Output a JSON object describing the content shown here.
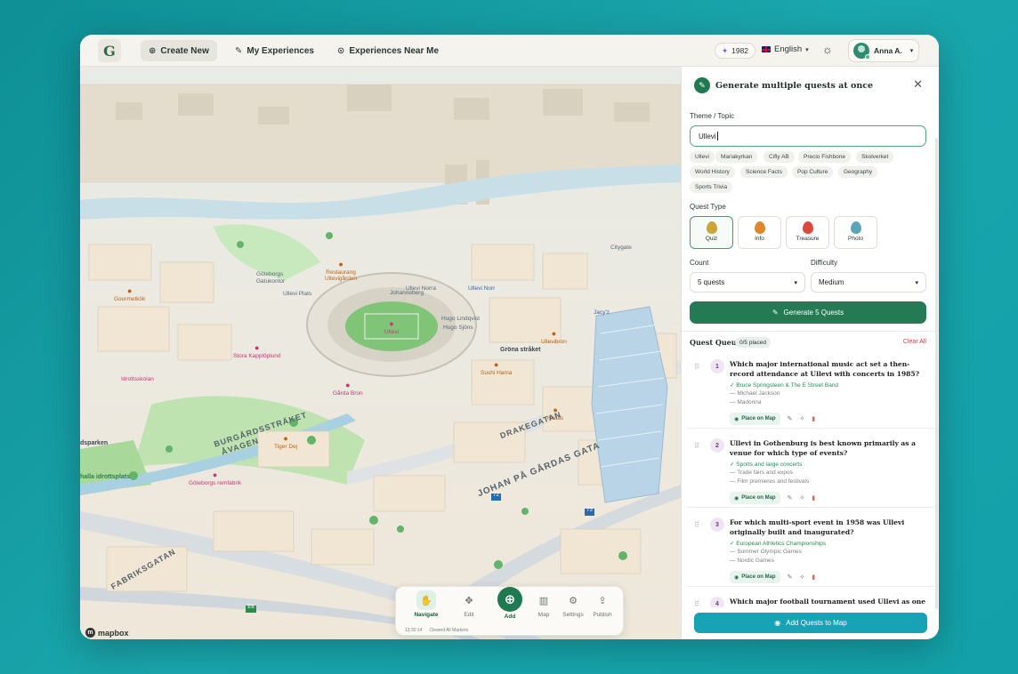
{
  "topbar": {
    "nav": [
      "Create New",
      "My Experiences",
      "Experiences Near Me"
    ],
    "points": "1982",
    "language": "English",
    "user": "Anna A."
  },
  "map": {
    "pois": [
      {
        "label": "Restaurang\nUllevigården",
        "color": "orange"
      },
      {
        "label": "Gourmetkök",
        "color": "orange"
      },
      {
        "label": "Ullevi",
        "color": "pink"
      },
      {
        "label": "Stora Kapplöplund",
        "color": "pink"
      },
      {
        "label": "Gårda Bron",
        "color": "pink"
      },
      {
        "label": "Sushi Hama",
        "color": "orange"
      },
      {
        "label": "Hildas",
        "color": "orange"
      },
      {
        "label": "Tiger Dej",
        "color": "orange"
      },
      {
        "label": "Göteborgs remfabrik",
        "color": "pink"
      },
      {
        "label": "Ullevi Norr",
        "color": "blue"
      },
      {
        "label": "Jacy'z",
        "color": "blue"
      },
      {
        "label": "Ullevibron",
        "color": "orange"
      },
      {
        "label": "Idrottsskolan",
        "color": "pink"
      }
    ],
    "streets": [
      "Göteborgs",
      "Gatukontor",
      "Ullevi Plats",
      "Ullevi Norra",
      "Johanneberg",
      "Hugo Lindqvist",
      "Hugo Sjöns",
      "Citygate",
      "Gröna stråket",
      "DRAKEGATAN",
      "BURGÅRDSSTRÄKET",
      "ÅVAGEN",
      "JOHAN PÅ GÅRDAS GATA",
      "FABRIKSGATAN",
      "dsparken",
      "halla idrottsplats"
    ],
    "road_shields": [
      "72",
      "73",
      "E6"
    ],
    "attribution": "mapbox"
  },
  "toolbar": {
    "items": [
      "Navigate",
      "Edit",
      "Add",
      "Map",
      "Settings",
      "Publish"
    ],
    "active": "Navigate",
    "footer_time": "13:32:14",
    "footer_status": "Cleared All Markers"
  },
  "panel": {
    "title": "Generate multiple quests at once",
    "theme_label": "Theme / Topic",
    "theme_value": "Ullevi",
    "tags": [
      "Ullevi",
      "Mariakyrkan",
      "Cifly AB",
      "Precio Fishbone",
      "Skolverket",
      "World History",
      "Science Facts",
      "Pop Culture",
      "Geography",
      "Sports Trivia"
    ],
    "quest_type_label": "Quest Type",
    "quest_types": [
      {
        "label": "Quiz",
        "color": "#c9a53a"
      },
      {
        "label": "Info",
        "color": "#e0862c"
      },
      {
        "label": "Treasure",
        "color": "#d94a3d"
      },
      {
        "label": "Photo",
        "color": "#5aa6b8"
      }
    ],
    "selected_type": "Quiz",
    "count_label": "Count",
    "count_value": "5 quests",
    "difficulty_label": "Difficulty",
    "difficulty_value": "Medium",
    "generate_button": "Generate 5 Quests",
    "queue_title": "Quest Queue",
    "queue_badge": "0/5 placed",
    "clear_all": "Clear All",
    "place_label": "Place on Map",
    "questions": [
      {
        "num": "1",
        "text": "Which major international music act set a then-record attendance at Ullevi with concerts in 1985?",
        "correct": "Bruce Springsteen & The E Street Band",
        "wrong": [
          "Michael Jackson",
          "Madonna"
        ]
      },
      {
        "num": "2",
        "text": "Ullevi in Gothenburg is best known primarily as a venue for which type of events?",
        "correct": "Sports and large concerts",
        "wrong": [
          "Trade fairs and expos",
          "Film premieres and festivals"
        ]
      },
      {
        "num": "3",
        "text": "For which multi-sport event in 1958 was Ullevi originally built and inaugurated?",
        "correct": "European Athletics Championships",
        "wrong": [
          "Summer Olympic Games",
          "Nordic Games"
        ]
      },
      {
        "num": "4",
        "text": "Which major football tournament used Ullevi as one of its key"
      }
    ],
    "add_button": "Add Quests to Map"
  }
}
